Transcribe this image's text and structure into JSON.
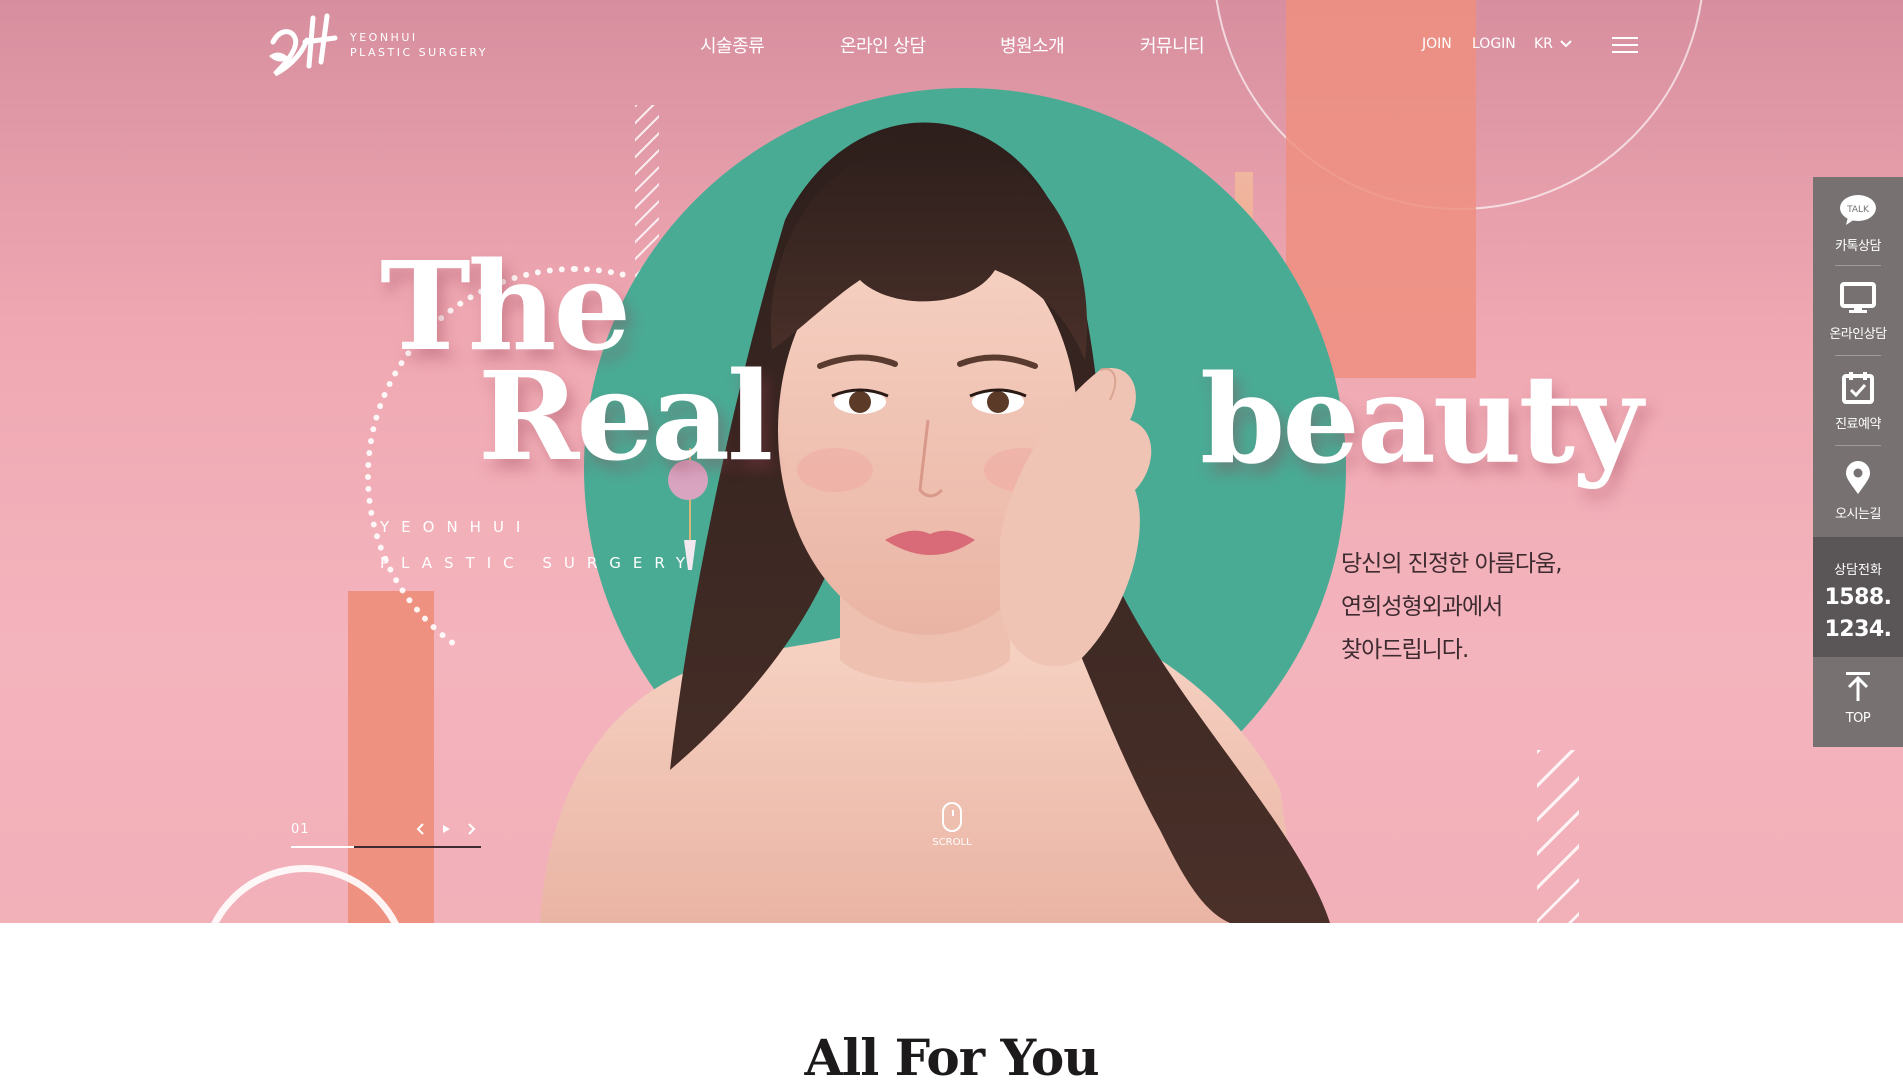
{
  "header": {
    "logo_text_line1": "YEONHUI",
    "logo_text_line2": "PLASTIC SURGERY",
    "nav": [
      "시술종류",
      "온라인 상담",
      "병원소개",
      "커뮤니티"
    ],
    "join": "JOIN",
    "login": "LOGIN",
    "lang": "KR"
  },
  "hero": {
    "word_the": "The",
    "word_real": "Real",
    "word_beauty": "beauty",
    "brand_line1": "YEONHUI",
    "brand_line2": "PLASTIC SURGERY",
    "tagline": [
      "당신의 진정한 아름다움,",
      "연희성형외과에서",
      "찾아드립니다."
    ],
    "slide_number": "01",
    "progress_fraction": 0.33,
    "scroll_label": "SCROLL"
  },
  "quick_menu": {
    "items": [
      {
        "icon": "talk-bubble-icon",
        "badge": "TALK",
        "label": "카톡상담"
      },
      {
        "icon": "monitor-icon",
        "label": "온라인상담"
      },
      {
        "icon": "calendar-check-icon",
        "label": "진료예약"
      },
      {
        "icon": "map-pin-icon",
        "label": "오시는길"
      }
    ],
    "phone_title": "상담전화",
    "phone_line1": "1588.",
    "phone_line2": "1234.",
    "top_label": "TOP"
  },
  "section": {
    "title": "All For You"
  },
  "colors": {
    "teal": "#4aab95",
    "coral": "#ef8f80",
    "pink_bg": "#f4b4bd",
    "quick_menu_bg": "#777172"
  }
}
